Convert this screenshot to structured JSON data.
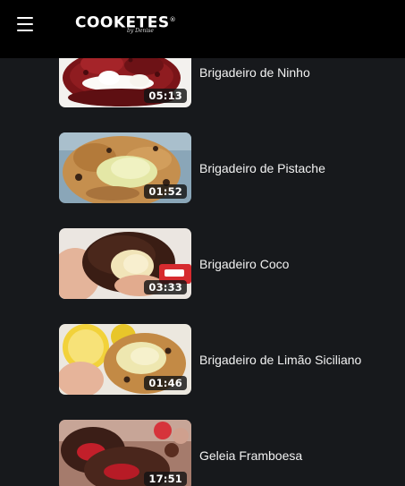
{
  "header": {
    "brand": "COOKETES",
    "brand_registered": "®",
    "brand_tagline": "by Denise",
    "menu_icon": "hamburger-menu-icon",
    "background": "#000000"
  },
  "videos": [
    {
      "title": "Brigadeiro de Ninho",
      "duration": "05:13"
    },
    {
      "title": "Brigadeiro de Pistache",
      "duration": "01:52"
    },
    {
      "title": "Brigadeiro Coco",
      "duration": "03:33"
    },
    {
      "title": "Brigadeiro de Limão Siciliano",
      "duration": "01:46"
    },
    {
      "title": "Geleia Framboesa",
      "duration": "17:51"
    }
  ],
  "colors": {
    "page_background": "#17191c",
    "title_text": "#f2f2f2",
    "duration_badge": "#141414"
  }
}
